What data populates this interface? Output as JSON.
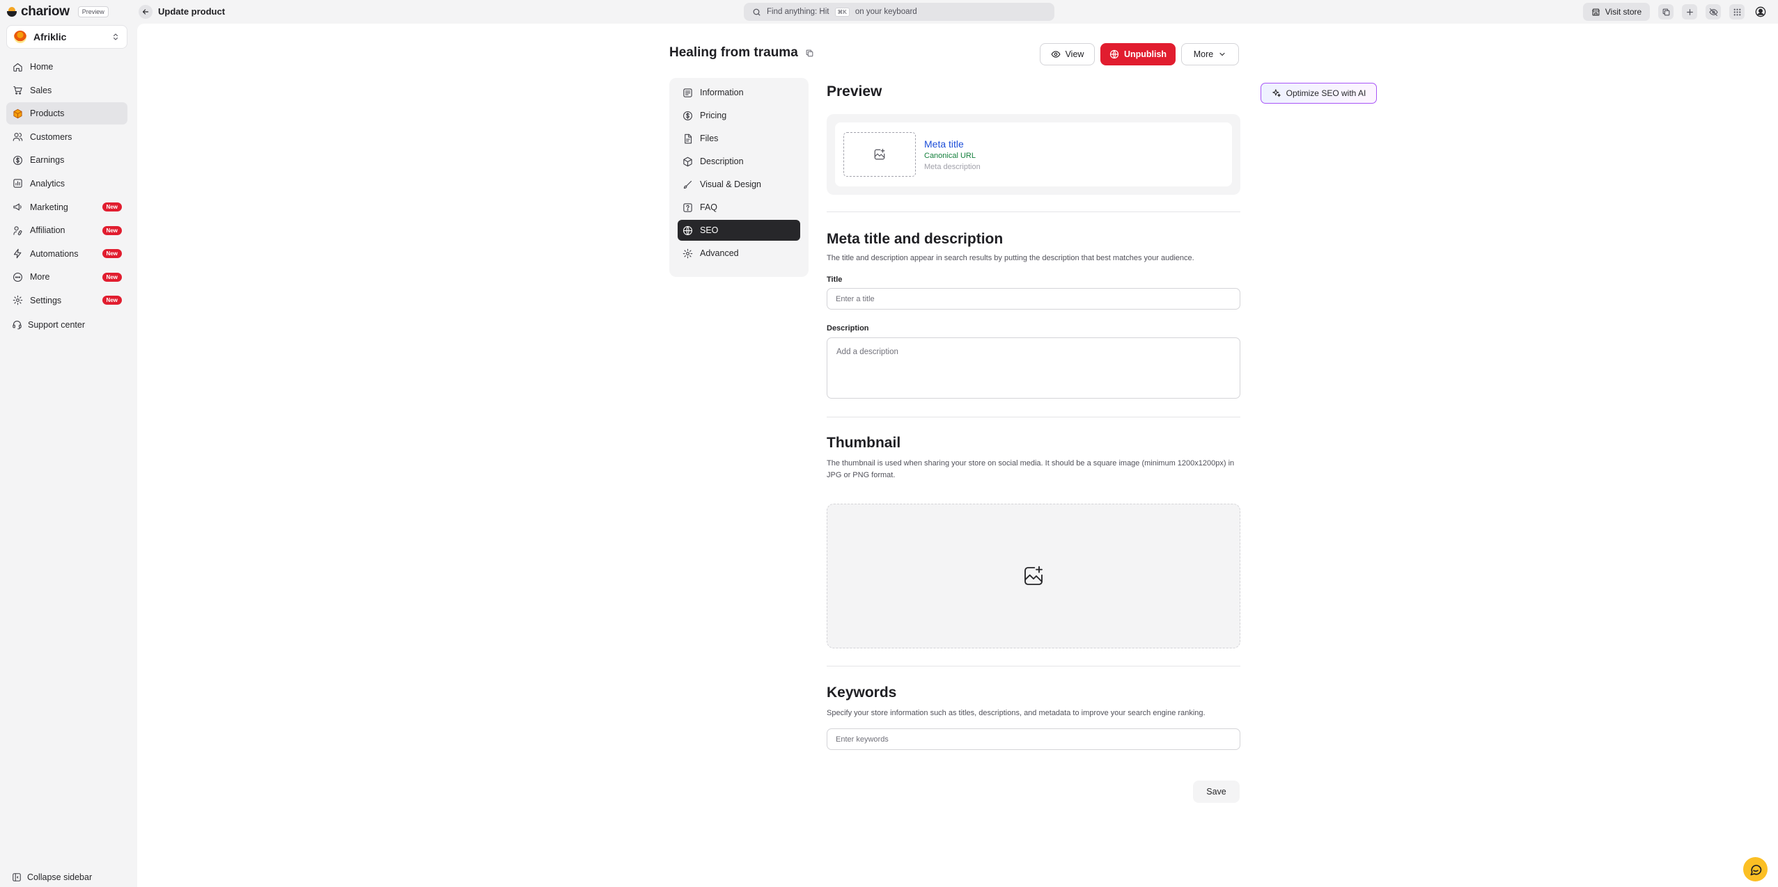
{
  "app": {
    "brand": "chariow",
    "preview_tag": "Preview",
    "store_name": "Afriklic"
  },
  "sidebar": {
    "items": [
      {
        "label": "Home",
        "icon": "home-icon"
      },
      {
        "label": "Sales",
        "icon": "cart-icon"
      },
      {
        "label": "Products",
        "icon": "box-icon",
        "active": true
      },
      {
        "label": "Customers",
        "icon": "users-icon"
      },
      {
        "label": "Earnings",
        "icon": "dollar-icon"
      },
      {
        "label": "Analytics",
        "icon": "chart-icon"
      },
      {
        "label": "Marketing",
        "icon": "megaphone-icon",
        "badge": "New"
      },
      {
        "label": "Affiliation",
        "icon": "user-link-icon",
        "badge": "New"
      },
      {
        "label": "Automations",
        "icon": "bolt-icon",
        "badge": "New"
      },
      {
        "label": "More",
        "icon": "more-icon",
        "badge": "New"
      },
      {
        "label": "Settings",
        "icon": "gear-icon",
        "badge": "New"
      }
    ],
    "support": "Support center",
    "collapse": "Collapse sidebar"
  },
  "topbar": {
    "page": "Update product",
    "search_prefix": "Find anything: Hit",
    "search_kbd": "⌘K",
    "search_suffix": "on your keyboard",
    "visit_store": "Visit store"
  },
  "product": {
    "title": "Healing from trauma",
    "view": "View",
    "unpublish": "Unpublish",
    "more": "More"
  },
  "sections": [
    {
      "label": "Information",
      "icon": "info-list-icon"
    },
    {
      "label": "Pricing",
      "icon": "dollar-icon"
    },
    {
      "label": "Files",
      "icon": "file-icon"
    },
    {
      "label": "Description",
      "icon": "box-icon"
    },
    {
      "label": "Visual & Design",
      "icon": "brush-icon"
    },
    {
      "label": "FAQ",
      "icon": "question-icon"
    },
    {
      "label": "SEO",
      "icon": "globe-icon",
      "active": true
    },
    {
      "label": "Advanced",
      "icon": "gear-icon"
    }
  ],
  "seo": {
    "preview_heading": "Preview",
    "optimize_ai": "Optimize SEO with AI",
    "meta_title": "Meta title",
    "canonical_url": "Canonical URL",
    "meta_description": "Meta description",
    "meta_heading": "Meta title and description",
    "meta_help": "The title and description appear in search results by putting the description that best matches your audience.",
    "title_label": "Title",
    "title_placeholder": "Enter a title",
    "description_label": "Description",
    "description_placeholder": "Add a description",
    "thumbnail_heading": "Thumbnail",
    "thumbnail_help": "The thumbnail is used when sharing your store on social media. It should be a square image (minimum 1200x1200px) in JPG or PNG format.",
    "keywords_heading": "Keywords",
    "keywords_help": "Specify your store information such as titles, descriptions, and metadata to improve your search engine ranking.",
    "keywords_placeholder": "Enter keywords",
    "save": "Save"
  },
  "colors": {
    "accent_red": "#e11d2f",
    "link_blue": "#1d4ed8",
    "url_green": "#15803d",
    "ai_purple": "#a855f7"
  }
}
